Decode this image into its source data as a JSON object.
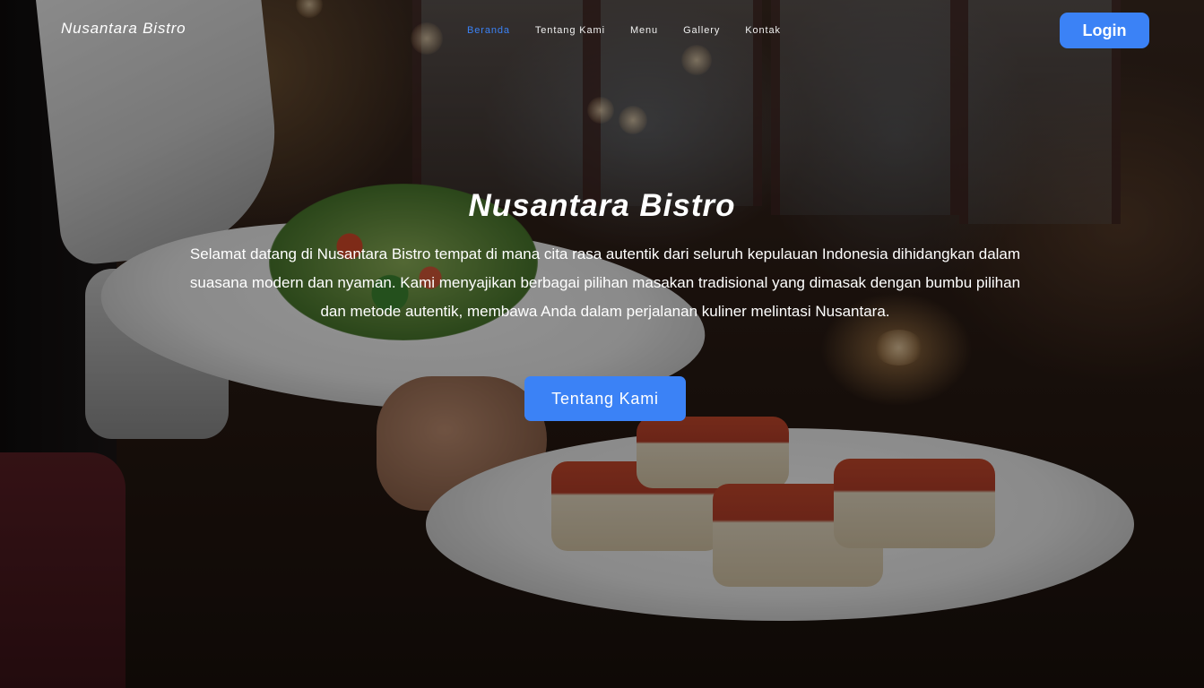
{
  "navbar": {
    "brand": "Nusantara Bistro",
    "links": [
      {
        "label": "Beranda",
        "active": true
      },
      {
        "label": "Tentang Kami",
        "active": false
      },
      {
        "label": "Menu",
        "active": false
      },
      {
        "label": "Gallery",
        "active": false
      },
      {
        "label": "Kontak",
        "active": false
      }
    ],
    "login_label": "Login"
  },
  "hero": {
    "title": "Nusantara Bistro",
    "description": "Selamat datang di Nusantara Bistro tempat di mana cita rasa autentik dari seluruh kepulauan Indonesia dihidangkan dalam suasana modern dan nyaman. Kami menyajikan berbagai pilihan masakan tradisional yang dimasak dengan bumbu pilihan dan metode autentik, membawa Anda dalam perjalanan kuliner melintasi Nusantara.",
    "cta_label": "Tentang Kami"
  },
  "colors": {
    "accent": "#3b82f6",
    "text": "#ffffff"
  }
}
